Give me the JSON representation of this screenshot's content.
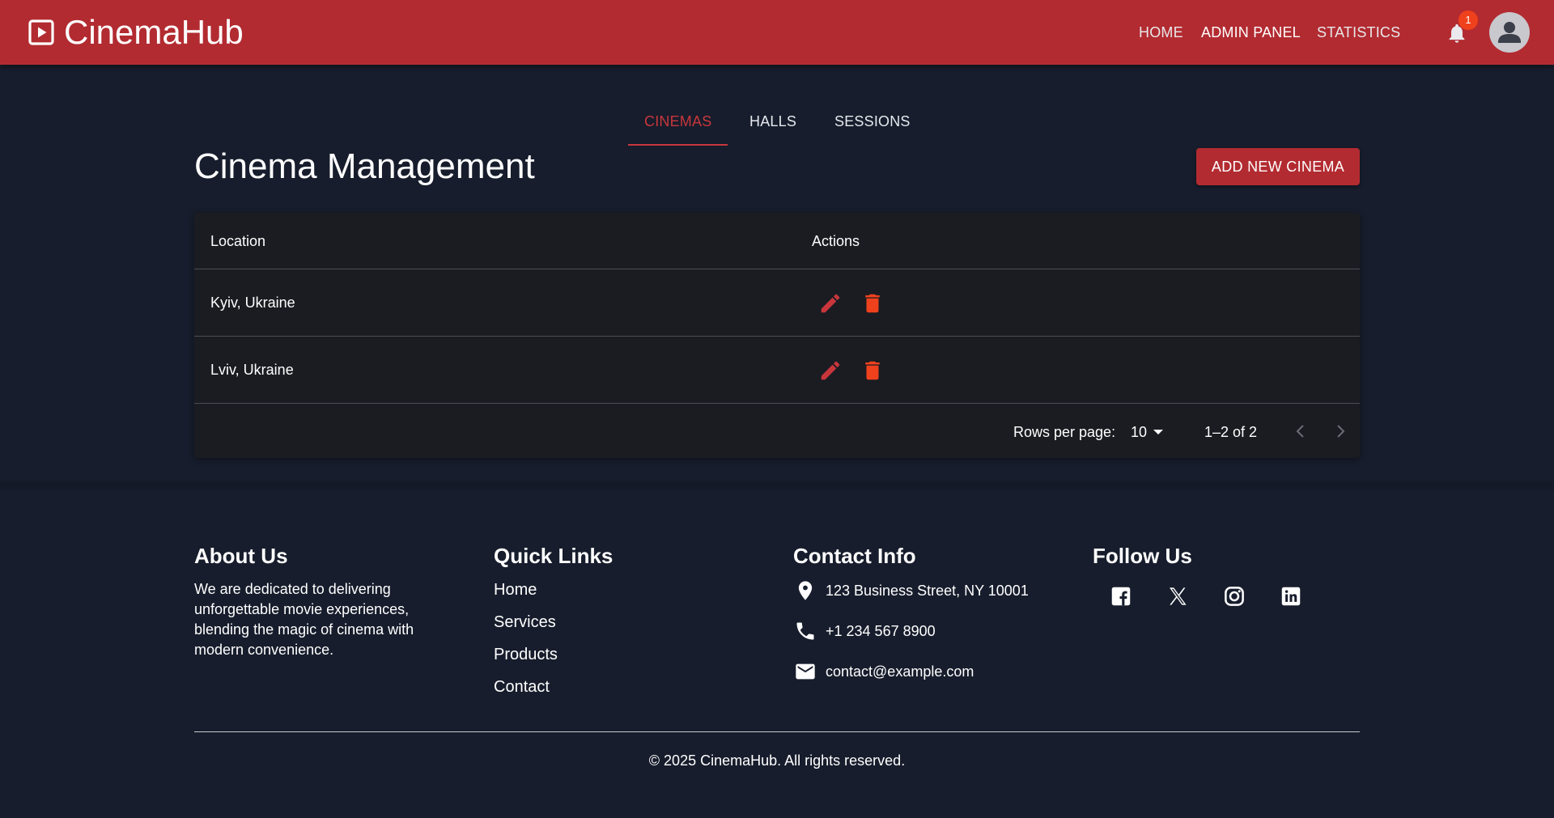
{
  "app": {
    "name": "CinemaHub",
    "logo_icon": "play-square-icon",
    "brand_color": "#b22b31",
    "accent_color": "#c8363c"
  },
  "header": {
    "nav": [
      "HOME",
      "ADMIN PANEL",
      "STATISTICS"
    ],
    "active_nav": "ADMIN PANEL",
    "notification_icon": "bell-icon",
    "notification_count": "1",
    "avatar_icon": "account-circle-icon"
  },
  "tabs": {
    "items": [
      "CINEMAS",
      "HALLS",
      "SESSIONS"
    ],
    "active": "CINEMAS"
  },
  "page": {
    "title": "Cinema Management",
    "add_button": "ADD NEW CINEMA"
  },
  "table": {
    "columns": [
      "Location",
      "Actions"
    ],
    "rows": [
      {
        "location": "Kyiv, Ukraine",
        "actions": [
          "edit-icon",
          "delete-icon"
        ]
      },
      {
        "location": "Lviv, Ukraine",
        "actions": [
          "edit-icon",
          "delete-icon"
        ]
      }
    ],
    "pagination": {
      "rows_per_page_label": "Rows per page:",
      "rows_per_page": "10",
      "range": "1–2 of 2"
    }
  },
  "footer": {
    "about": {
      "heading": "About Us",
      "text": "We are dedicated to delivering unforgettable movie experiences, blending the magic of cinema with modern convenience."
    },
    "quick_links": {
      "heading": "Quick Links",
      "items": [
        "Home",
        "Services",
        "Products",
        "Contact"
      ]
    },
    "contact": {
      "heading": "Contact Info",
      "address": "123 Business Street, NY 10001",
      "phone": "+1 234 567 8900",
      "email": "contact@example.com",
      "icons": [
        "location-pin-icon",
        "phone-icon",
        "mail-icon"
      ]
    },
    "follow": {
      "heading": "Follow Us",
      "networks": [
        "facebook-icon",
        "x-icon",
        "instagram-icon",
        "linkedin-icon"
      ]
    },
    "copyright": "© 2025 CinemaHub. All rights reserved."
  }
}
